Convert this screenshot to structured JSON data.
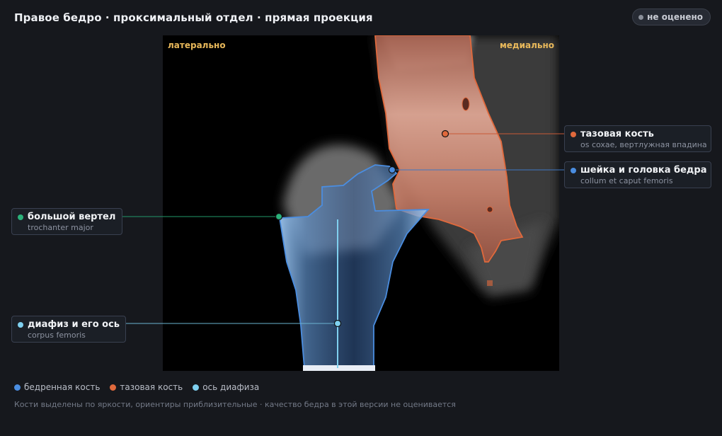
{
  "header": {
    "title": "Правое бедро · проксимальный отдел · прямая проекция",
    "status": "не оценено"
  },
  "viewer": {
    "orientation_left": "латерально",
    "orientation_right": "медиально"
  },
  "landmarks": {
    "pelvis": {
      "name": "тазовая кость",
      "latin": "os coxae, вертлужная впадина",
      "color": "#e0693c"
    },
    "neck": {
      "name": "шейка и головка бедра",
      "latin": "collum et caput femoris",
      "color": "#4a8de0"
    },
    "trochanter": {
      "name": "большой вертел",
      "latin": "trochanter major",
      "color": "#2bb27a"
    },
    "shaft": {
      "name": "диафиз и его ось",
      "latin": "corpus femoris",
      "color": "#7fd0ef"
    }
  },
  "legend": [
    {
      "label": "бедренная кость",
      "color": "#4a8de0"
    },
    {
      "label": "тазовая кость",
      "color": "#e0693c"
    },
    {
      "label": "ось диафиза",
      "color": "#7fd0ef"
    }
  ],
  "footnote": "Кости выделены по яркости, ориентиры приблизительные · качество бедра в этой версии не оценивается"
}
